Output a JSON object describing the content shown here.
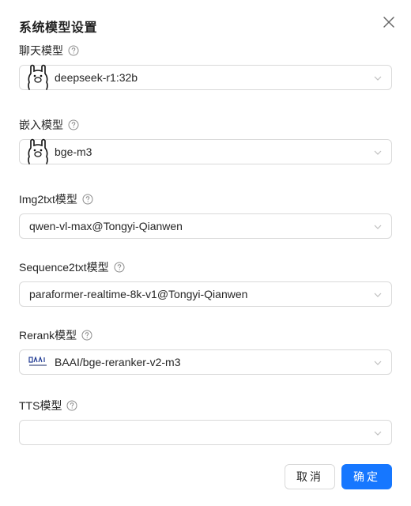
{
  "dialog": {
    "title": "系统模型设置",
    "close_icon": "close-icon",
    "fields": {
      "chat": {
        "label": "聊天模型",
        "value": "deepseek-r1:32b",
        "icon": "ollama-llama-icon"
      },
      "embed": {
        "label": "嵌入模型",
        "value": "bge-m3",
        "icon": "ollama-llama-icon"
      },
      "img2txt": {
        "label": "Img2txt模型",
        "value": "qwen-vl-max@Tongyi-Qianwen"
      },
      "seq2txt": {
        "label": "Sequence2txt模型",
        "value": "paraformer-realtime-8k-v1@Tongyi-Qianwen"
      },
      "rerank": {
        "label": "Rerank模型",
        "value": "BAAI/bge-reranker-v2-m3",
        "icon": "baai-logo-icon"
      },
      "tts": {
        "label": "TTS模型",
        "value": ""
      }
    },
    "buttons": {
      "cancel": "取消",
      "ok": "确定"
    }
  },
  "colors": {
    "primary": "#1677ff",
    "border": "#d9d9d9"
  }
}
